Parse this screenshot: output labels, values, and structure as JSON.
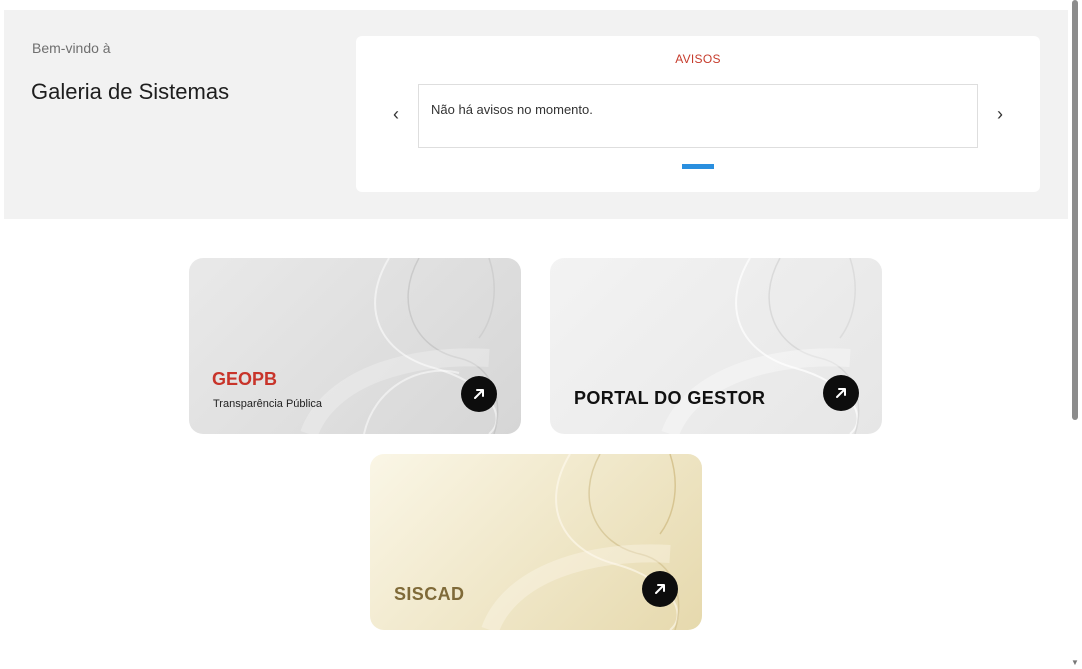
{
  "hero": {
    "welcome": "Bem-vindo à",
    "title": "Galeria de Sistemas"
  },
  "notices": {
    "title": "AVISOS",
    "message": "Não há avisos no momento.",
    "prev_icon": "chevron-left-icon",
    "next_icon": "chevron-right-icon",
    "prev_glyph": "‹",
    "next_glyph": "›",
    "page_count": 1,
    "active_page": 1
  },
  "systems": [
    {
      "name": "GEOPB",
      "subtitle": "Transparência Pública",
      "title_color": "#c8342a",
      "icon": "arrow-up-right-icon"
    },
    {
      "name": "PORTAL DO GESTOR",
      "title_color": "#111111",
      "icon": "arrow-up-right-icon"
    },
    {
      "name": "SISCAD",
      "title_color": "#7f6a38",
      "icon": "arrow-up-right-icon"
    }
  ],
  "colors": {
    "accent_red": "#c63b2b",
    "carousel_dot": "#2a8fdf",
    "hero_bg": "#f2f2f2"
  }
}
